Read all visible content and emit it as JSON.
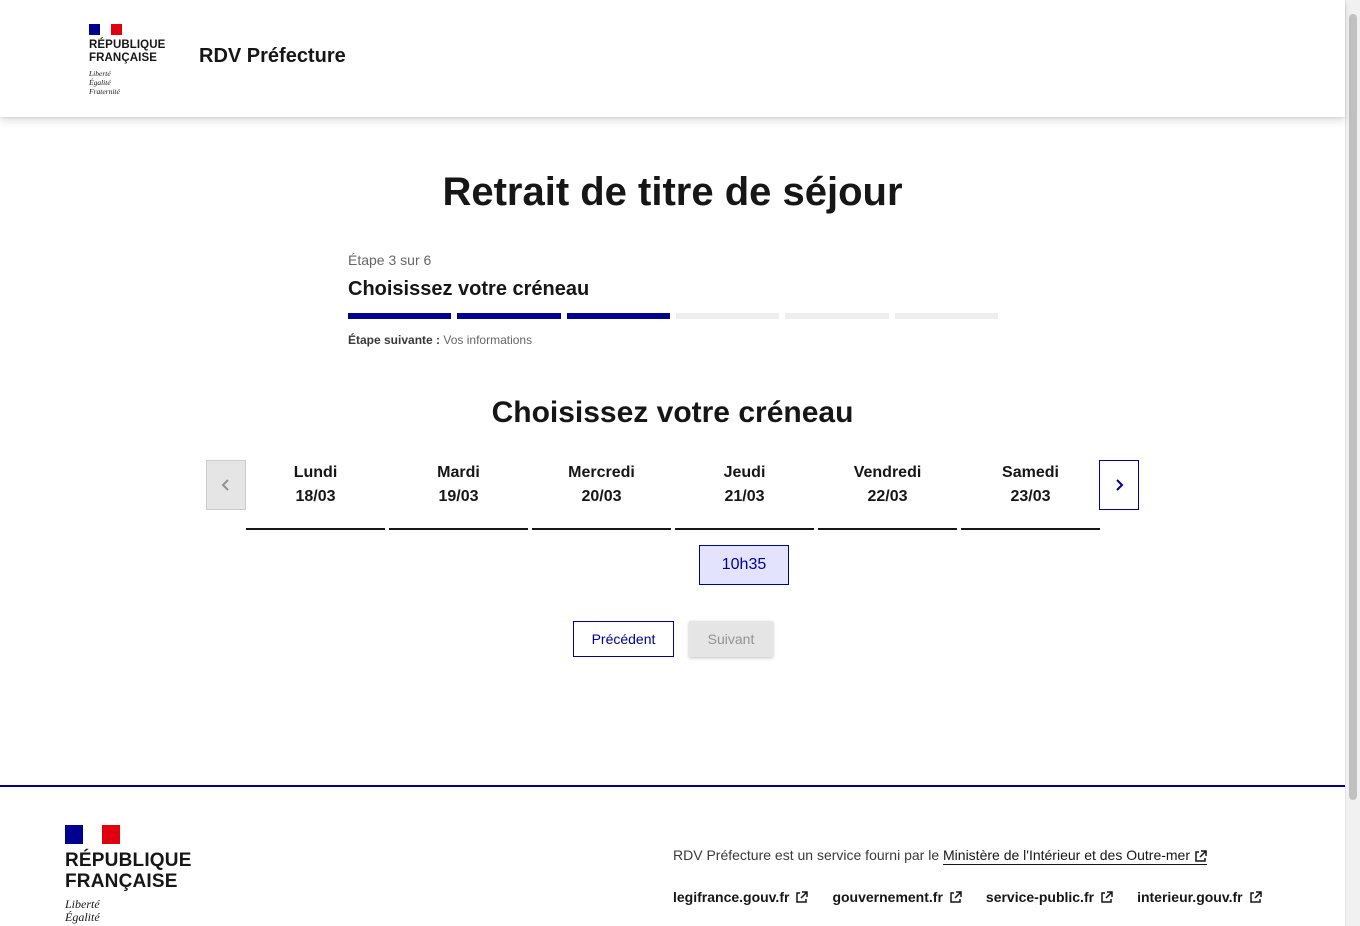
{
  "header": {
    "logo_line1": "RÉPUBLIQUE",
    "logo_line2": "FRANÇAISE",
    "motto": [
      "Liberté",
      "Égalité",
      "Fraternité"
    ],
    "service_title": "RDV Préfecture"
  },
  "page_title": "Retrait de titre de séjour",
  "stepper": {
    "state": "Étape 3 sur 6",
    "title": "Choisissez votre créneau",
    "current_step": 3,
    "total_steps": 6,
    "next_label": "Étape suivante :",
    "next_value": "Vos informations"
  },
  "section_title": "Choisissez votre créneau",
  "days": [
    {
      "name": "Lundi",
      "date": "18/03"
    },
    {
      "name": "Mardi",
      "date": "19/03"
    },
    {
      "name": "Mercredi",
      "date": "20/03"
    },
    {
      "name": "Jeudi",
      "date": "21/03"
    },
    {
      "name": "Vendredi",
      "date": "22/03"
    },
    {
      "name": "Samedi",
      "date": "23/03"
    }
  ],
  "slot": {
    "time": "10h35",
    "day": "Jeudi"
  },
  "buttons": {
    "previous": "Précédent",
    "next": "Suivant"
  },
  "footer": {
    "logo_line1": "RÉPUBLIQUE",
    "logo_line2": "FRANÇAISE",
    "motto": [
      "Liberté",
      "Égalité"
    ],
    "description": "RDV Préfecture est un service fourni par le",
    "ministry_link": "Ministère de l'Intérieur et des Outre-mer",
    "links": [
      "legifrance.gouv.fr",
      "gouvernement.fr",
      "service-public.fr",
      "interieur.gouv.fr"
    ]
  },
  "colors": {
    "primary": "#000091",
    "slot_bg": "#e3e3fd",
    "flag_red": "#e1000f"
  },
  "icons": {
    "prev": "chevron-left-icon",
    "next": "chevron-right-icon",
    "external": "external-link-icon"
  }
}
